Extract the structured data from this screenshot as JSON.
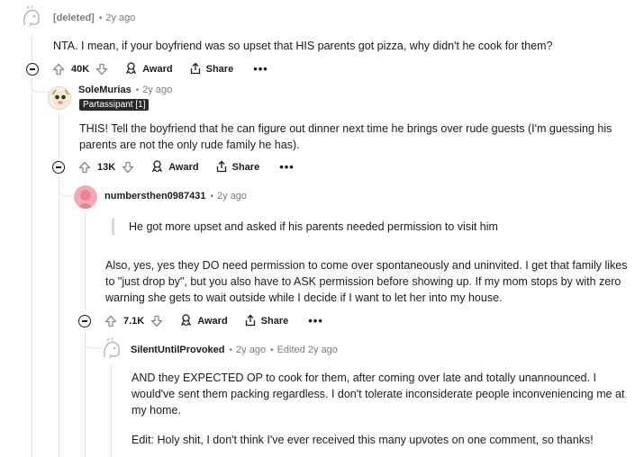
{
  "comments": [
    {
      "author": "[deleted]",
      "time": "2y ago",
      "body": "NTA. I mean, if your boyfriend was so upset that HIS parents got pizza, why didn't he cook for them?",
      "votes": "40K",
      "award": "Award",
      "share": "Share",
      "more": "•••"
    },
    {
      "author": "SoleMurias",
      "time": "2y ago",
      "flair": "Partassipant [1]",
      "body": "THIS! Tell the boyfriend that he can figure out dinner next time he brings over rude guests (I'm guessing his parents are not the only rude family he has).",
      "votes": "13K",
      "award": "Award",
      "share": "Share",
      "more": "•••"
    },
    {
      "author": "numbersthen0987431",
      "time": "2y ago",
      "quote": "He got more upset and asked if his parents needed permission to visit him",
      "body": "Also, yes, yes they DO need permission to come over spontaneously and uninvited. I get that family likes to \"just drop by\", but you also have to ASK permission before showing up. If my mom stops by with zero warning she gets to wait outside while I decide if I want to let her into my house.",
      "votes": "7.1K",
      "award": "Award",
      "share": "Share",
      "more": "•••"
    },
    {
      "author": "SilentUntilProvoked",
      "time": "2y ago",
      "edited": "Edited 2y ago",
      "body": "AND they EXPECTED OP to cook for them, after coming over late and totally unannounced. I would've sent them packing regardless. I don't tolerate inconsiderate people inconveniencing me at my home.",
      "edit_note": "Edit: Holy shit, I don't think I've ever received this many upvotes on one comment, so thanks!"
    }
  ]
}
